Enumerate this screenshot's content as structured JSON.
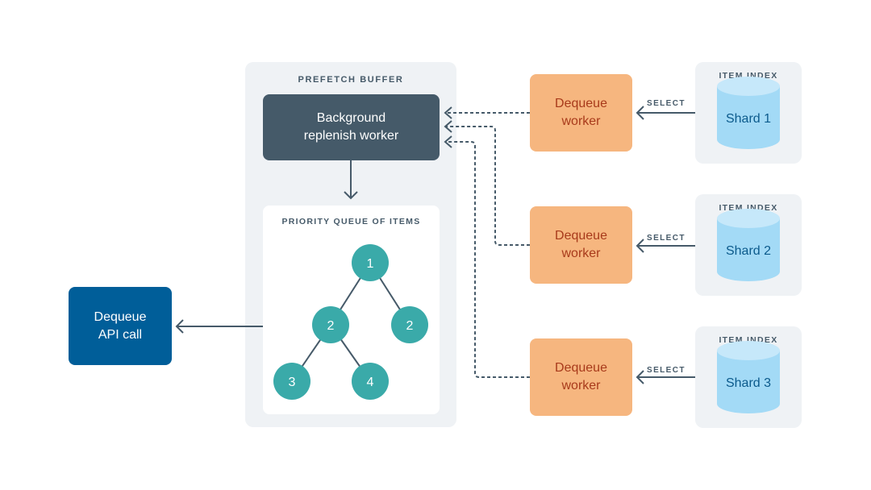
{
  "prefetch_buffer": {
    "title": "PREFETCH BUFFER",
    "background_worker": "Background\nreplenish worker",
    "priority_queue": {
      "title": "PRIORITY QUEUE OF ITEMS",
      "nodes": [
        {
          "id": "root",
          "value": "1"
        },
        {
          "id": "left",
          "value": "2",
          "parent": "root"
        },
        {
          "id": "right",
          "value": "2",
          "parent": "root"
        },
        {
          "id": "left-left",
          "value": "3",
          "parent": "left"
        },
        {
          "id": "left-right",
          "value": "4",
          "parent": "left"
        }
      ]
    }
  },
  "api_call": "Dequeue\nAPI call",
  "workers": [
    {
      "label": "Dequeue\nworker"
    },
    {
      "label": "Dequeue\nworker"
    },
    {
      "label": "Dequeue\nworker"
    }
  ],
  "edge_label": "SELECT",
  "item_indexes": [
    {
      "title": "ITEM INDEX",
      "shard": "Shard 1"
    },
    {
      "title": "ITEM INDEX",
      "shard": "Shard 2"
    },
    {
      "title": "ITEM INDEX",
      "shard": "Shard 3"
    }
  ],
  "colors": {
    "panel": "#eff2f5",
    "background_worker": "#455a69",
    "api_call": "#005e99",
    "dequeue_worker": "#f6b67f",
    "dequeue_worker_text": "#a83a1b",
    "tree_node": "#3aaaa9",
    "shard_body": "#a3daf6",
    "shard_top": "#c6e8fa",
    "shard_text": "#0b5a8c",
    "connector": "#465a69"
  }
}
